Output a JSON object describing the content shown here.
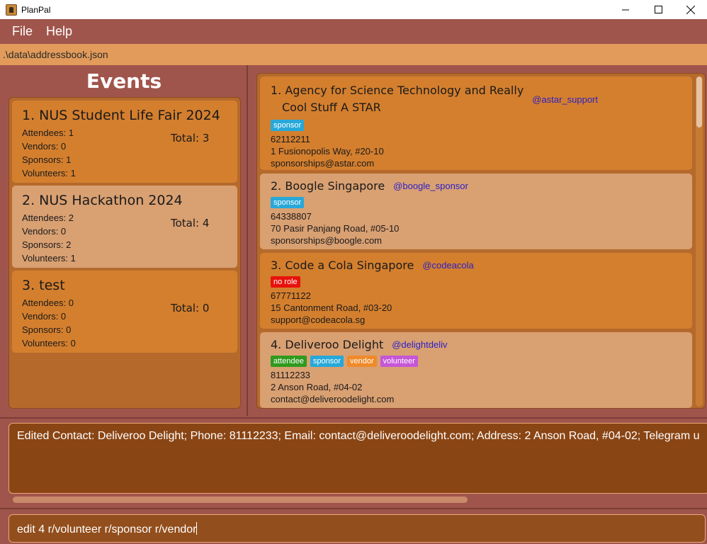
{
  "window": {
    "title": "PlanPal"
  },
  "menu": {
    "file": "File",
    "help": "Help"
  },
  "path": ".\\data\\addressbook.json",
  "events": {
    "title": "Events",
    "items": [
      {
        "name": "1. NUS Student Life Fair 2024",
        "attendees": "Attendees: 1",
        "vendors": "Vendors: 0",
        "sponsors": "Sponsors: 1",
        "volunteers": "Volunteers: 1",
        "total": "Total: 3"
      },
      {
        "name": "2. NUS Hackathon 2024",
        "attendees": "Attendees: 2",
        "vendors": "Vendors: 0",
        "sponsors": "Sponsors: 2",
        "volunteers": "Volunteers: 1",
        "total": "Total: 4"
      },
      {
        "name": "3. test",
        "attendees": "Attendees: 0",
        "vendors": "Vendors: 0",
        "sponsors": "Sponsors: 0",
        "volunteers": "Volunteers: 0",
        "total": "Total: 0"
      }
    ]
  },
  "contacts": [
    {
      "name_line1": "1. Agency for Science Technology and Really",
      "name_line2": "Cool Stuff A STAR",
      "handle": "@astar_support",
      "tags": [
        "sponsor"
      ],
      "phone": "62112211",
      "address": "1 Fusionopolis Way, #20-10",
      "email": "sponsorships@astar.com"
    },
    {
      "name": "2. Boogle Singapore",
      "handle": "@boogle_sponsor",
      "tags": [
        "sponsor"
      ],
      "phone": "64338807",
      "address": "70 Pasir Panjang Road, #05-10",
      "email": "sponsorships@boogle.com"
    },
    {
      "name": "3. Code a Cola Singapore",
      "handle": "@codeacola",
      "tags": [
        "no role"
      ],
      "phone": "67771122",
      "address": "15 Cantonment Road, #03-20",
      "email": "support@codeacola.sg"
    },
    {
      "name": "4. Deliveroo Delight",
      "handle": "@delightdeliv",
      "tags": [
        "attendee",
        "sponsor",
        "vendor",
        "volunteer"
      ],
      "phone": "81112233",
      "address": "2 Anson Road, #04-02",
      "email": "contact@deliveroodelight.com"
    }
  ],
  "result": "Edited Contact: Deliveroo Delight; Phone: 81112233; Email: contact@deliveroodelight.com; Address: 2 Anson Road, #04-02; Telegram u",
  "command": "edit 4 r/volunteer r/sponsor r/vendor",
  "colors": {
    "menu_bg": "#a0554c",
    "path_bg": "#e29b5a",
    "card_dark": "#d47f2e",
    "card_light": "#d9a072",
    "handle": "#2a1fc8"
  }
}
